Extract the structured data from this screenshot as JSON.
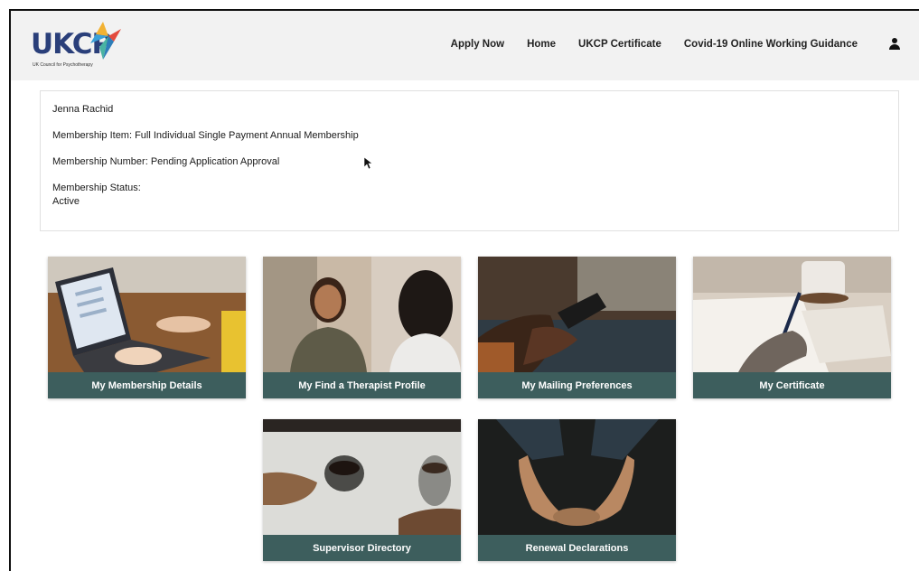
{
  "logo": {
    "text": "UKCP",
    "subtitle": "UK Council for Psychotherapy"
  },
  "nav": {
    "items": [
      {
        "label": "Apply Now"
      },
      {
        "label": "Home"
      },
      {
        "label": "UKCP Certificate"
      },
      {
        "label": "Covid-19 Online Working Guidance"
      }
    ]
  },
  "member": {
    "name": "Jenna Rachid",
    "membership_item": "Membership Item: Full Individual Single Payment Annual Membership",
    "membership_number": "Membership Number: Pending Application Approval",
    "status_label": "Membership Status:",
    "status_value": "Active"
  },
  "cards": [
    {
      "label": "My Membership Details"
    },
    {
      "label": "My Find a Therapist Profile"
    },
    {
      "label": "My Mailing Preferences"
    },
    {
      "label": "My Certificate"
    },
    {
      "label": "Supervisor Directory"
    },
    {
      "label": "Renewal Declarations"
    }
  ],
  "colors": {
    "card_label_bg": "#3d5e5d",
    "header_bg": "#f2f2f2",
    "logo_blue": "#2a3f7a"
  }
}
